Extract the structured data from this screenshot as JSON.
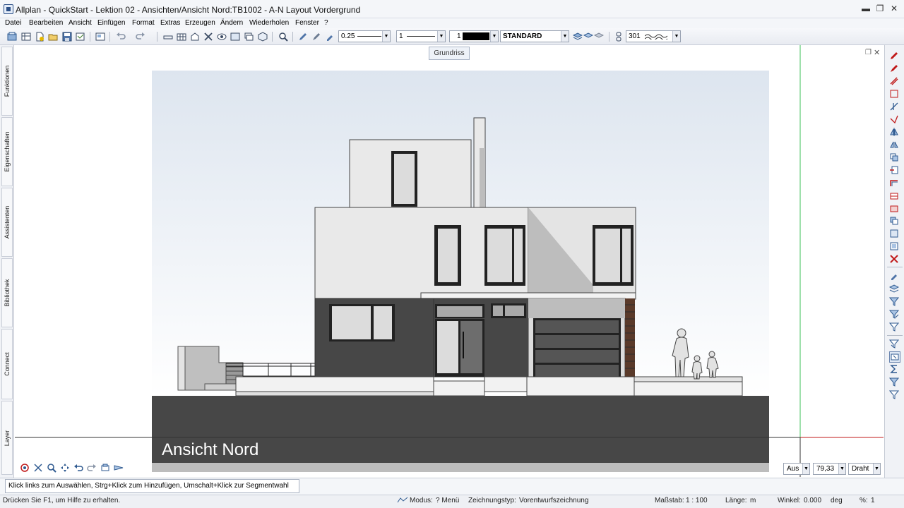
{
  "window": {
    "title": "Allplan - QuickStart - Lektion 02 - Ansichten/Ansicht Nord:TB1002 - A-N Layout Vordergrund",
    "min_label": "▬",
    "restore_label": "❐",
    "close_label": "✕"
  },
  "menu": [
    {
      "label": "Datei"
    },
    {
      "label": "Bearbeiten"
    },
    {
      "label": "Ansicht"
    },
    {
      "label": "Einfügen"
    },
    {
      "label": "Format"
    },
    {
      "label": "Extras"
    },
    {
      "label": "Erzeugen"
    },
    {
      "label": "Ändern"
    },
    {
      "label": "Wiederholen"
    },
    {
      "label": "Fenster"
    },
    {
      "label": "?"
    }
  ],
  "toolbar": {
    "pen_value": "0.25",
    "line_value": "1",
    "color_value": "1",
    "layer_value": "STANDARD",
    "pattern_value": "301"
  },
  "side_tabs": [
    "Funktionen",
    "Eigenschaften",
    "Assistenten",
    "Bibliothek",
    "Connect",
    "Layer"
  ],
  "drawing": {
    "tooltip": "Grundriss",
    "view_label": "Ansicht Nord"
  },
  "view_controls": {
    "mode": "Aus",
    "scale": "79,33",
    "render": "Draht"
  },
  "hint": "Klick links zum Auswählen, Strg+Klick zum Hinzufügen, Umschalt+Klick zur Segmentwahl",
  "status": {
    "help": "Drücken Sie F1, um Hilfe zu erhalten.",
    "modus_label": "Modus:",
    "modus_value": "? Menü",
    "zeichnungstyp_label": "Zeichnungstyp:",
    "zeichnungstyp_value": "Vorentwurfszeichnung",
    "massstab_label": "Maßstab:",
    "massstab_value": "1 : 100",
    "laenge_label": "Länge:",
    "laenge_value": "m",
    "winkel_label": "Winkel:",
    "winkel_value": "0.000",
    "winkel_unit": "deg",
    "percent_label": "%:",
    "percent_value": "1"
  },
  "colors": {
    "facade_white": "#e9e9e9",
    "facade_dark": "#444444",
    "ground": "#474747",
    "sky_top": "#dde5ef",
    "accent_green": "#3fc05a",
    "accent_red": "#c01818"
  }
}
